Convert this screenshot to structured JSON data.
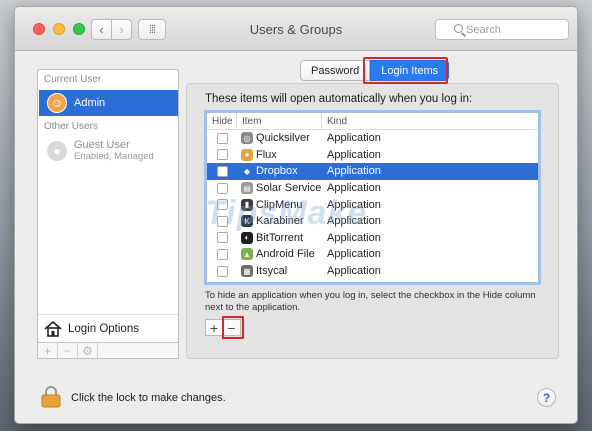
{
  "window": {
    "title": "Users & Groups"
  },
  "toolbar": {
    "search_placeholder": "Search"
  },
  "sidebar": {
    "current_user_heading": "Current User",
    "current_user": {
      "name": "Admin"
    },
    "other_users_heading": "Other Users",
    "other_users": [
      {
        "name": "Guest User",
        "subtitle": "Enabled, Managed"
      }
    ],
    "login_options_label": "Login Options"
  },
  "tabs": {
    "password": "Password",
    "login_items": "Login Items"
  },
  "login_items": {
    "intro": "These items will open automatically when you log in:",
    "columns": {
      "hide": "Hide",
      "item": "Item",
      "kind": "Kind"
    },
    "rows": [
      {
        "item": "Quicksilver",
        "kind": "Application",
        "icon": "quicksilver-icon",
        "color": "#8a8a8a",
        "glyph": "◎"
      },
      {
        "item": "Flux",
        "kind": "Application",
        "icon": "flux-icon",
        "color": "#e5a43b",
        "glyph": "●"
      },
      {
        "item": "Dropbox",
        "kind": "Application",
        "icon": "dropbox-icon",
        "color": "#2d6fd1",
        "glyph": "◆"
      },
      {
        "item": "Solar Service",
        "kind": "Application",
        "icon": "solar-service-icon",
        "color": "#9a9a9a",
        "glyph": "▤"
      },
      {
        "item": "ClipMenu",
        "kind": "Application",
        "icon": "clipmenu-icon",
        "color": "#3c3c3c",
        "glyph": "▮"
      },
      {
        "item": "Karabiner",
        "kind": "Application",
        "icon": "karabiner-icon",
        "color": "#2f3c4e",
        "glyph": "K"
      },
      {
        "item": "BitTorrent",
        "kind": "Application",
        "icon": "bittorrent-icon",
        "color": "#1f1f1f",
        "glyph": "◐"
      },
      {
        "item": "Android File",
        "kind": "Application",
        "icon": "android-file-icon",
        "color": "#7bb34a",
        "glyph": "▲"
      },
      {
        "item": "Itsycal",
        "kind": "Application",
        "icon": "itsycal-icon",
        "color": "#6c6c6c",
        "glyph": "▦"
      }
    ],
    "selected_index": 2,
    "help_text": "To hide an application when you log in, select the checkbox in the Hide column next to the application."
  },
  "footer": {
    "lock_text": "Click the lock to make changes."
  },
  "watermark": "TipsMake"
}
